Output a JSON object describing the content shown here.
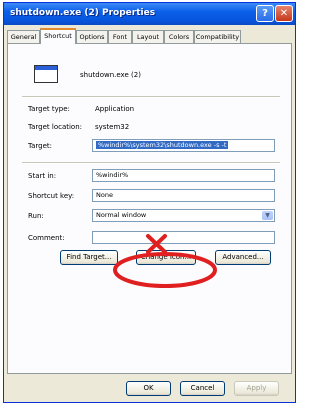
{
  "window": {
    "title": "shutdown.exe (2) Properties",
    "help_glyph": "?",
    "close_glyph": "✕"
  },
  "tabs": [
    {
      "label": "General"
    },
    {
      "label": "Shortcut"
    },
    {
      "label": "Options"
    },
    {
      "label": "Font"
    },
    {
      "label": "Layout"
    },
    {
      "label": "Colors"
    },
    {
      "label": "Compatibility"
    }
  ],
  "shortcut": {
    "name": "shutdown.exe (2)",
    "target_type_label": "Target type:",
    "target_type_value": "Application",
    "target_location_label": "Target location:",
    "target_location_value": "system32",
    "target_label": "Target:",
    "target_value": "%windir%\\system32\\shutdown.exe -s -t",
    "start_in_label": "Start in:",
    "start_in_value": "%windir%",
    "shortcut_key_label": "Shortcut key:",
    "shortcut_key_value": "None",
    "run_label": "Run:",
    "run_value": "Normal window",
    "comment_label": "Comment:",
    "comment_value": "",
    "find_target": "Find Target...",
    "change_icon": "Change Icon...",
    "advanced": "Advanced..."
  },
  "footer": {
    "ok": "OK",
    "cancel": "Cancel",
    "apply": "Apply"
  },
  "colors": {
    "annotation": "#e02020"
  }
}
